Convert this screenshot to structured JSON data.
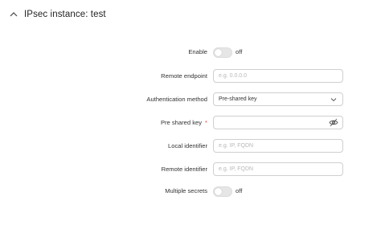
{
  "section": {
    "title": "IPsec instance: test"
  },
  "form": {
    "enable": {
      "label": "Enable",
      "state_text": "off"
    },
    "remote_endpoint": {
      "label": "Remote endpoint",
      "placeholder": "e.g. 0.0.0.0"
    },
    "auth_method": {
      "label": "Authentication method",
      "value": "Pre-shared key"
    },
    "pre_shared_key": {
      "label": "Pre shared key",
      "required_mark": "*"
    },
    "local_identifier": {
      "label": "Local identifier",
      "placeholder": "e.g. IP, FQDN"
    },
    "remote_identifier": {
      "label": "Remote identifier",
      "placeholder": "e.g. IP, FQDN"
    },
    "multiple_secrets": {
      "label": "Multiple secrets",
      "state_text": "off"
    }
  },
  "icons": {
    "section_toggle": "chevron-up-icon",
    "select_arrow": "chevron-down-icon",
    "password_visibility": "eye-slash-icon"
  },
  "colors": {
    "required": "#e0483f",
    "border": "#cfcfcf",
    "toggle_off": "#e6e6e6"
  }
}
